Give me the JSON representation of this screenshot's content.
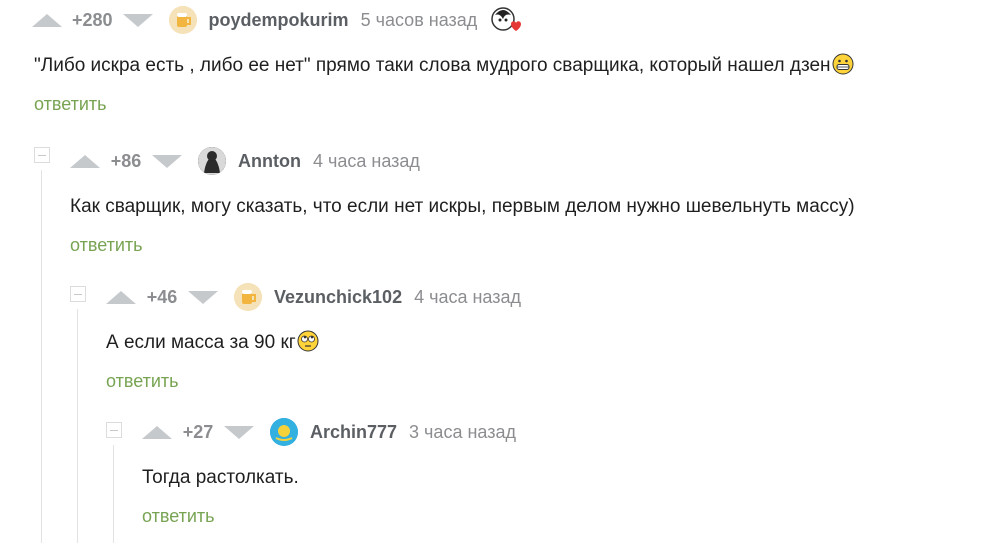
{
  "comments": [
    {
      "rating": "+280",
      "username": "poydempokurim",
      "time": "5 часов назад",
      "text": "\"Либо искра есть , либо ее нет\" прямо таки слова мудрого сварщика, который нашел дзен",
      "reply_label": "ответить",
      "emoji_icon": "grinning-face-icon"
    },
    {
      "rating": "+86",
      "username": "Annton",
      "time": "4 часа назад",
      "text": "Как сварщик, могу сказать, что если нет искры, первым делом нужно шевельнуть массу)",
      "reply_label": "ответить"
    },
    {
      "rating": "+46",
      "username": "Vezunchick102",
      "time": "4 часа назад",
      "text": "А если масса за 90 кг",
      "reply_label": "ответить",
      "emoji_icon": "rolling-eyes-icon"
    },
    {
      "rating": "+27",
      "username": "Archin777",
      "time": "3 часа назад",
      "text": "Тогда растолкать.",
      "reply_label": "ответить"
    }
  ],
  "colors": {
    "reply": "#77a352",
    "arrow": "#c6c9cc",
    "username": "#5b5f63"
  }
}
